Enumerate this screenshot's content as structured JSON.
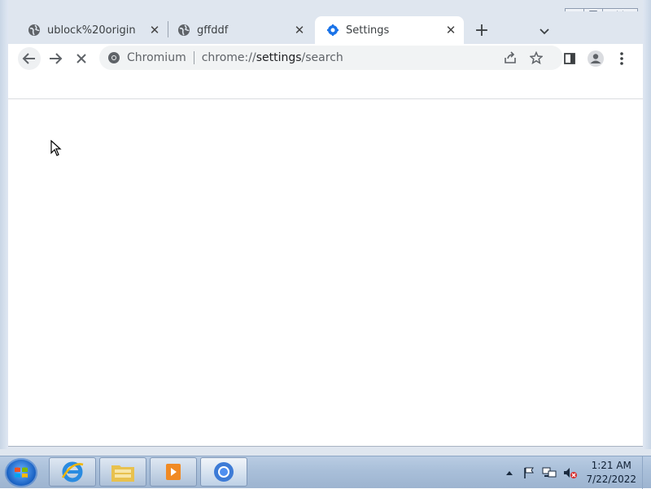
{
  "tabs": [
    {
      "label": "ublock%20origin",
      "icon": "globe-icon"
    },
    {
      "label": "gffddf",
      "icon": "globe-icon"
    },
    {
      "label": "Settings",
      "icon": "settings-gear-icon",
      "active": true
    }
  ],
  "tab_close_glyph": "✕",
  "new_tab_glyph": "+",
  "toolbar": {
    "site_label": "Chromium",
    "url_prefix": "chrome://",
    "url_host": "settings",
    "url_path": "/search"
  },
  "clock": {
    "time": "1:21 AM",
    "date": "7/22/2022"
  },
  "colors": {
    "accent": "#1a73e8",
    "tabstrip": "#dfe6ef",
    "taskbar": "#a9bfd9"
  }
}
